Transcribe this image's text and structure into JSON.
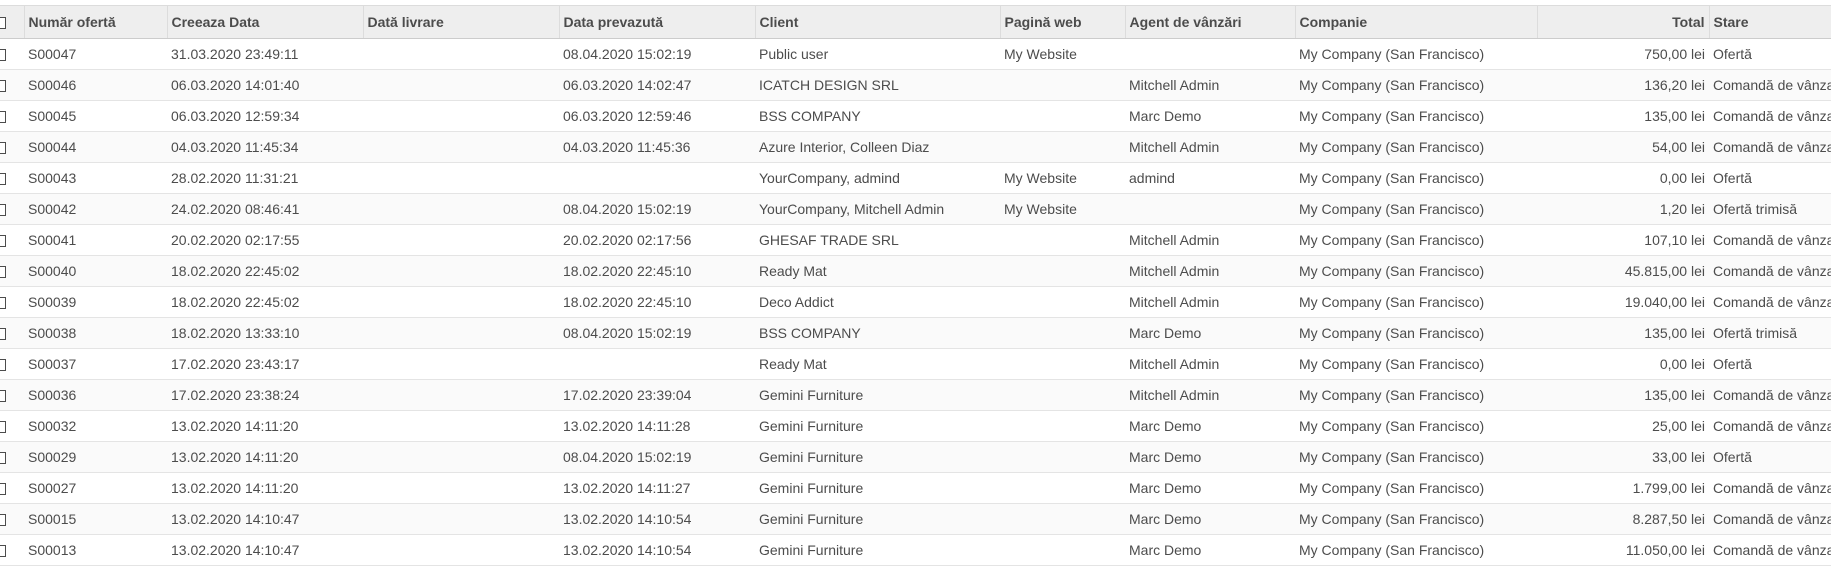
{
  "columns": {
    "number": "Număr ofertă",
    "created": "Creeaza Data",
    "delivery": "Dată livrare",
    "expected": "Data prevazută",
    "client": "Client",
    "website": "Pagină web",
    "agent": "Agent de vânzări",
    "company": "Companie",
    "total": "Total",
    "state": "Stare"
  },
  "rows": [
    {
      "number": "S00047",
      "created": "31.03.2020 23:49:11",
      "delivery": "",
      "expected": "08.04.2020 15:02:19",
      "client": "Public user",
      "website": "My Website",
      "agent": "",
      "company": "My Company (San Francisco)",
      "total": "750,00 lei",
      "state": "Ofertă"
    },
    {
      "number": "S00046",
      "created": "06.03.2020 14:01:40",
      "delivery": "",
      "expected": "06.03.2020 14:02:47",
      "client": "ICATCH DESIGN SRL",
      "website": "",
      "agent": "Mitchell Admin",
      "company": "My Company (San Francisco)",
      "total": "136,20 lei",
      "state": "Comandă de vânzare"
    },
    {
      "number": "S00045",
      "created": "06.03.2020 12:59:34",
      "delivery": "",
      "expected": "06.03.2020 12:59:46",
      "client": "BSS COMPANY",
      "website": "",
      "agent": "Marc Demo",
      "company": "My Company (San Francisco)",
      "total": "135,00 lei",
      "state": "Comandă de vânzare"
    },
    {
      "number": "S00044",
      "created": "04.03.2020 11:45:34",
      "delivery": "",
      "expected": "04.03.2020 11:45:36",
      "client": "Azure Interior, Colleen Diaz",
      "website": "",
      "agent": "Mitchell Admin",
      "company": "My Company (San Francisco)",
      "total": "54,00 lei",
      "state": "Comandă de vânzare"
    },
    {
      "number": "S00043",
      "created": "28.02.2020 11:31:21",
      "delivery": "",
      "expected": "",
      "client": "YourCompany, admind",
      "website": "My Website",
      "agent": "admind",
      "company": "My Company (San Francisco)",
      "total": "0,00 lei",
      "state": "Ofertă"
    },
    {
      "number": "S00042",
      "created": "24.02.2020 08:46:41",
      "delivery": "",
      "expected": "08.04.2020 15:02:19",
      "client": "YourCompany, Mitchell Admin",
      "website": "My Website",
      "agent": "",
      "company": "My Company (San Francisco)",
      "total": "1,20 lei",
      "state": "Ofertă trimisă"
    },
    {
      "number": "S00041",
      "created": "20.02.2020 02:17:55",
      "delivery": "",
      "expected": "20.02.2020 02:17:56",
      "client": "GHESAF TRADE SRL",
      "website": "",
      "agent": "Mitchell Admin",
      "company": "My Company (San Francisco)",
      "total": "107,10 lei",
      "state": "Comandă de vânzare"
    },
    {
      "number": "S00040",
      "created": "18.02.2020 22:45:02",
      "delivery": "",
      "expected": "18.02.2020 22:45:10",
      "client": "Ready Mat",
      "website": "",
      "agent": "Mitchell Admin",
      "company": "My Company (San Francisco)",
      "total": "45.815,00 lei",
      "state": "Comandă de vânzare"
    },
    {
      "number": "S00039",
      "created": "18.02.2020 22:45:02",
      "delivery": "",
      "expected": "18.02.2020 22:45:10",
      "client": "Deco Addict",
      "website": "",
      "agent": "Mitchell Admin",
      "company": "My Company (San Francisco)",
      "total": "19.040,00 lei",
      "state": "Comandă de vânzare"
    },
    {
      "number": "S00038",
      "created": "18.02.2020 13:33:10",
      "delivery": "",
      "expected": "08.04.2020 15:02:19",
      "client": "BSS COMPANY",
      "website": "",
      "agent": "Marc Demo",
      "company": "My Company (San Francisco)",
      "total": "135,00 lei",
      "state": "Ofertă trimisă"
    },
    {
      "number": "S00037",
      "created": "17.02.2020 23:43:17",
      "delivery": "",
      "expected": "",
      "client": "Ready Mat",
      "website": "",
      "agent": "Mitchell Admin",
      "company": "My Company (San Francisco)",
      "total": "0,00 lei",
      "state": "Ofertă"
    },
    {
      "number": "S00036",
      "created": "17.02.2020 23:38:24",
      "delivery": "",
      "expected": "17.02.2020 23:39:04",
      "client": "Gemini Furniture",
      "website": "",
      "agent": "Mitchell Admin",
      "company": "My Company (San Francisco)",
      "total": "135,00 lei",
      "state": "Comandă de vânzare"
    },
    {
      "number": "S00032",
      "created": "13.02.2020 14:11:20",
      "delivery": "",
      "expected": "13.02.2020 14:11:28",
      "client": "Gemini Furniture",
      "website": "",
      "agent": "Marc Demo",
      "company": "My Company (San Francisco)",
      "total": "25,00 lei",
      "state": "Comandă de vânzare"
    },
    {
      "number": "S00029",
      "created": "13.02.2020 14:11:20",
      "delivery": "",
      "expected": "08.04.2020 15:02:19",
      "client": "Gemini Furniture",
      "website": "",
      "agent": "Marc Demo",
      "company": "My Company (San Francisco)",
      "total": "33,00 lei",
      "state": "Ofertă"
    },
    {
      "number": "S00027",
      "created": "13.02.2020 14:11:20",
      "delivery": "",
      "expected": "13.02.2020 14:11:27",
      "client": "Gemini Furniture",
      "website": "",
      "agent": "Marc Demo",
      "company": "My Company (San Francisco)",
      "total": "1.799,00 lei",
      "state": "Comandă de vânzare"
    },
    {
      "number": "S00015",
      "created": "13.02.2020 14:10:47",
      "delivery": "",
      "expected": "13.02.2020 14:10:54",
      "client": "Gemini Furniture",
      "website": "",
      "agent": "Marc Demo",
      "company": "My Company (San Francisco)",
      "total": "8.287,50 lei",
      "state": "Comandă de vânzare"
    },
    {
      "number": "S00013",
      "created": "13.02.2020 14:10:47",
      "delivery": "",
      "expected": "13.02.2020 14:10:54",
      "client": "Gemini Furniture",
      "website": "",
      "agent": "Marc Demo",
      "company": "My Company (San Francisco)",
      "total": "11.050,00 lei",
      "state": "Comandă de vânzare"
    }
  ]
}
